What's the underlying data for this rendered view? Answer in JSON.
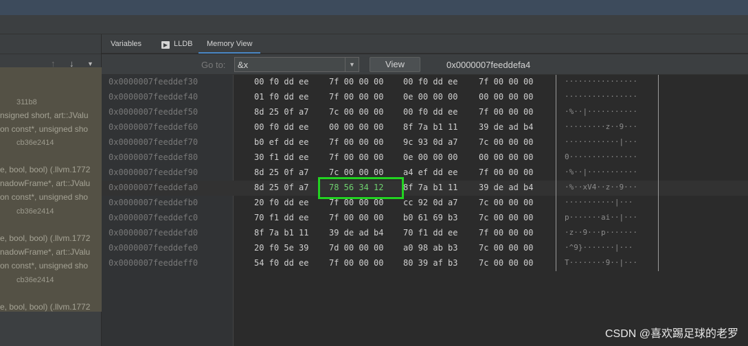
{
  "tabs": [
    {
      "label": "Variables",
      "icon": null
    },
    {
      "label": "LLDB",
      "icon": "terminal-icon"
    },
    {
      "label": "Memory View",
      "icon": null,
      "active": true
    }
  ],
  "goto": {
    "label": "Go to:",
    "value": "&x",
    "view_button": "View",
    "address": "0x0000007feeddefa4"
  },
  "frames_panel": {
    "lines": [
      "311b8",
      "nsigned short, art::JValu",
      "on const*, unsigned sho",
      "cb36e2414",
      "e, bool, bool) (.llvm.1772",
      "nadowFrame*, art::JValu",
      "on const*, unsigned sho",
      "cb36e2414",
      "e, bool, bool) (.llvm.1772",
      "nadowFrame*, art::JValu",
      "on const*, unsigned sho",
      "cb36e2414",
      "e, bool, bool) (.llvm.1772"
    ]
  },
  "memory": {
    "rows": [
      {
        "addr": "0x0000007feeddef30",
        "g": [
          "00 f0 dd ee",
          "7f 00 00 00",
          "00 f0 dd ee",
          "7f 00 00 00"
        ],
        "ascii": "················"
      },
      {
        "addr": "0x0000007feeddef40",
        "g": [
          "01 f0 dd ee",
          "7f 00 00 00",
          "0e 00 00 00",
          "00 00 00 00"
        ],
        "ascii": "················"
      },
      {
        "addr": "0x0000007feeddef50",
        "g": [
          "8d 25 0f a7",
          "7c 00 00 00",
          "00 f0 dd ee",
          "7f 00 00 00"
        ],
        "ascii": "·%··|···········"
      },
      {
        "addr": "0x0000007feeddef60",
        "g": [
          "00 f0 dd ee",
          "00 00 00 00",
          "8f 7a b1 11",
          "39 de ad b4"
        ],
        "ascii": "·········z··9···"
      },
      {
        "addr": "0x0000007feeddef70",
        "g": [
          "b0 ef dd ee",
          "7f 00 00 00",
          "9c 93 0d a7",
          "7c 00 00 00"
        ],
        "ascii": "············|···"
      },
      {
        "addr": "0x0000007feeddef80",
        "g": [
          "30 f1 dd ee",
          "7f 00 00 00",
          "0e 00 00 00",
          "00 00 00 00"
        ],
        "ascii": "0···············"
      },
      {
        "addr": "0x0000007feeddef90",
        "g": [
          "8d 25 0f a7",
          "7c 00 00 00",
          "a4 ef dd ee",
          "7f 00 00 00"
        ],
        "ascii": "·%··|···········"
      },
      {
        "addr": "0x0000007feeddefa0",
        "g": [
          "8d 25 0f a7",
          "78 56 34 12",
          "8f 7a b1 11",
          "39 de ad b4"
        ],
        "ascii": "·%··xV4··z··9···",
        "highlight": true
      },
      {
        "addr": "0x0000007feeddefb0",
        "g": [
          "20 f0 dd ee",
          "7f 00 00 00",
          "cc 92 0d a7",
          "7c 00 00 00"
        ],
        "ascii": " ···········|···"
      },
      {
        "addr": "0x0000007feeddefc0",
        "g": [
          "70 f1 dd ee",
          "7f 00 00 00",
          "b0 61 69 b3",
          "7c 00 00 00"
        ],
        "ascii": "p·······ai··|···"
      },
      {
        "addr": "0x0000007feeddefd0",
        "g": [
          "8f 7a b1 11",
          "39 de ad b4",
          "70 f1 dd ee",
          "7f 00 00 00"
        ],
        "ascii": "·z··9···p·······"
      },
      {
        "addr": "0x0000007feeddefe0",
        "g": [
          "20 f0 5e 39",
          "7d 00 00 00",
          "a0 98 ab b3",
          "7c 00 00 00"
        ],
        "ascii": " ·^9}·······|···"
      },
      {
        "addr": "0x0000007feeddeff0",
        "g": [
          "54 f0 dd ee",
          "7f 00 00 00",
          "80 39 af b3",
          "7c 00 00 00"
        ],
        "ascii": "T········9··|···"
      }
    ]
  },
  "watermark": "CSDN @喜欢踢足球的老罗",
  "colors": {
    "highlight_box": "#22d321",
    "tab_underline": "#4a88c7",
    "frames_bg": "#545145"
  }
}
